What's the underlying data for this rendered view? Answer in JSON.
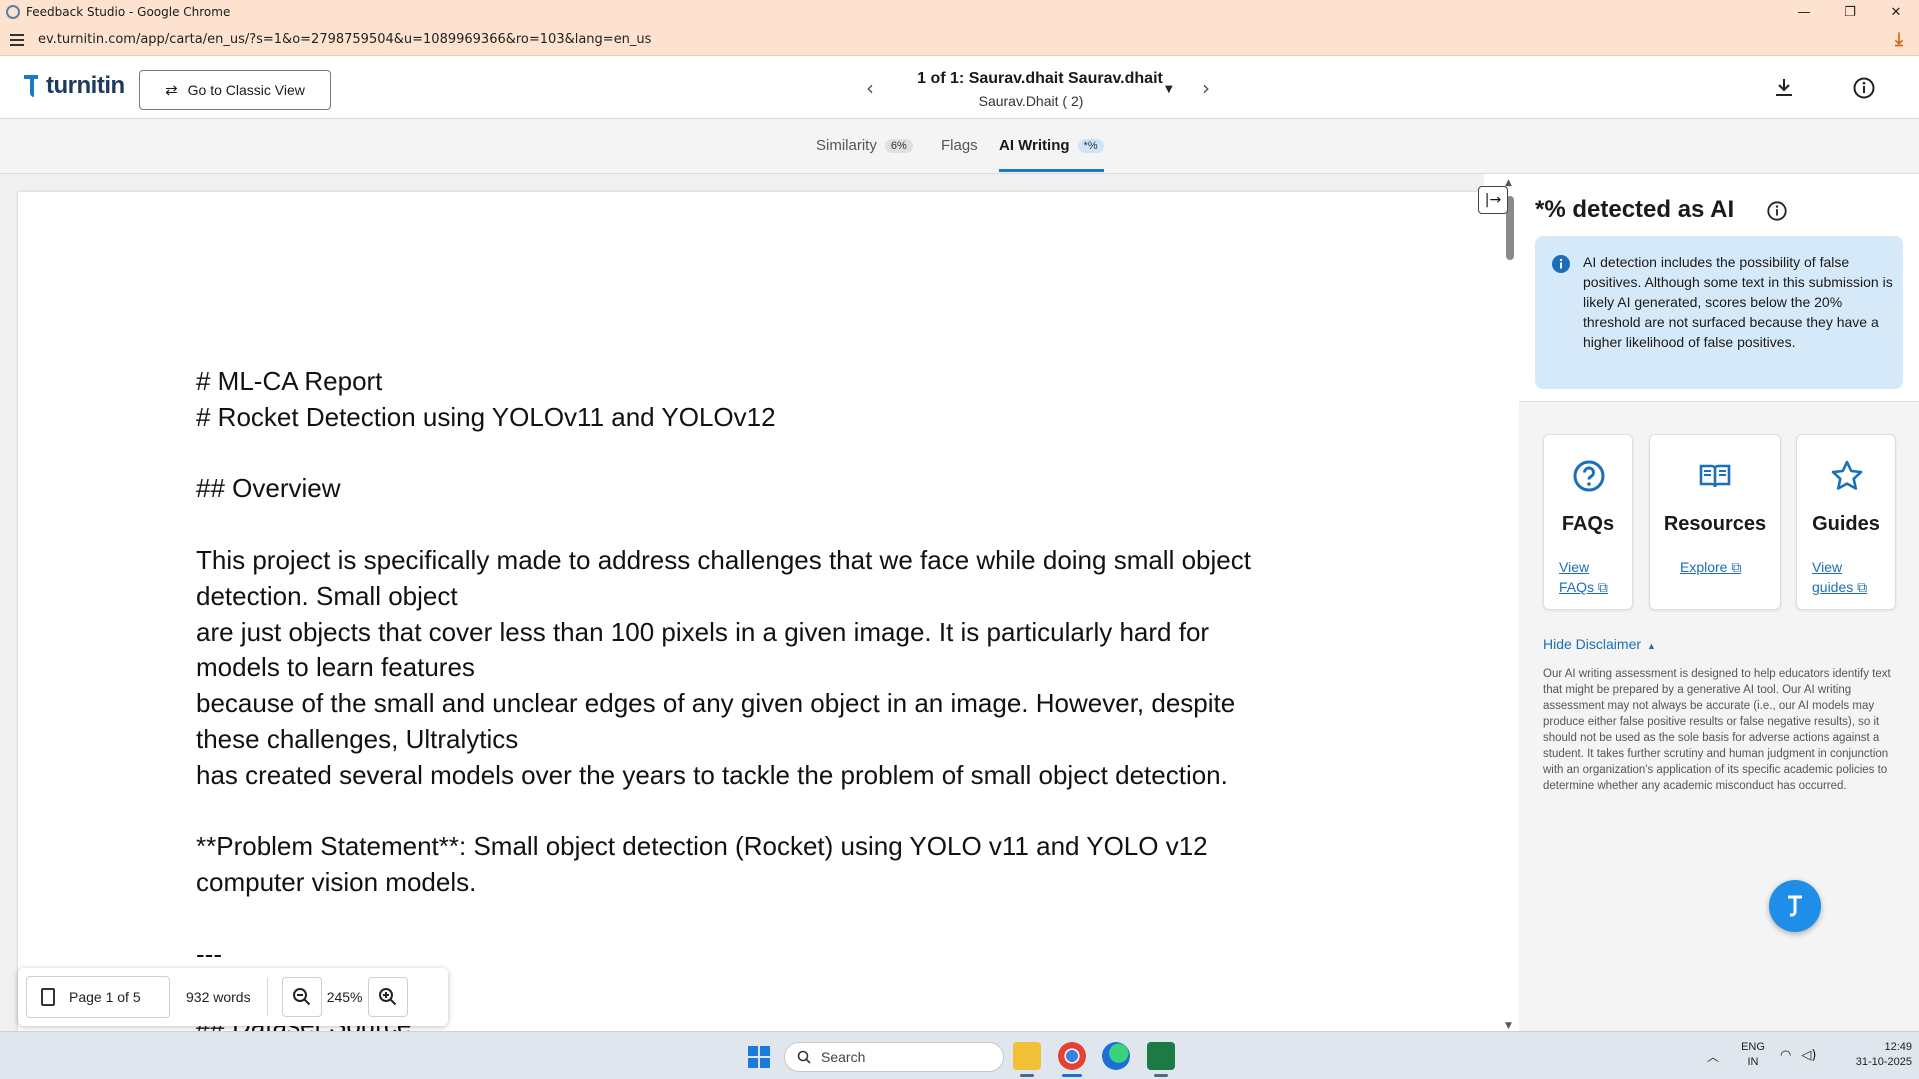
{
  "window": {
    "title": "Feedback Studio - Google Chrome",
    "url": "ev.turnitin.com/app/carta/en_us/?s=1&o=2798759504&u=1089969366&ro=103&lang=en_us"
  },
  "header": {
    "logo_text": "turnitin",
    "classic_view_label": "Go to Classic View",
    "submission_title": "1 of 1: Saurav.dhait Saurav.dhait",
    "submission_subtitle": "Saurav.Dhait ( 2)"
  },
  "tabs": [
    {
      "label": "Similarity",
      "badge": "6%"
    },
    {
      "label": "Flags",
      "badge": ""
    },
    {
      "label": "AI Writing",
      "badge": "*%"
    }
  ],
  "document": {
    "lines": [
      "# ML-CA Report",
      "# Rocket Detection using YOLOv11 and YOLOv12",
      "",
      "## Overview",
      "",
      "This project is specifically made to address challenges that we face while doing small object",
      "detection. Small object",
      "are just objects that cover less than 100 pixels in a given image. It is particularly hard for",
      "models to learn features",
      "because of the small and unclear edges of any given object in an image. However, despite",
      "these challenges, Ultralytics",
      "has created several models over the years to tackle the problem of small object detection.",
      "",
      "**Problem Statement**: Small object detection (Rocket) using YOLO v11 and YOLO v12",
      "computer vision models.",
      "",
      "---",
      "",
      "## Dataset Source"
    ]
  },
  "toolbar": {
    "page_label": "Page 1 of 5",
    "word_count": "932 words",
    "zoom_level": "245%"
  },
  "ai_panel": {
    "title": "*% detected as AI",
    "notice": "AI detection includes the possibility of false positives. Although some text in this submission is likely AI generated, scores below the 20% threshold are not surfaced because they have a higher likelihood of false positives.",
    "cards": [
      {
        "title": "FAQs",
        "link": "View FAQs",
        "icon": "question-circle-icon"
      },
      {
        "title": "Resources",
        "link": "Explore",
        "icon": "book-icon"
      },
      {
        "title": "Guides",
        "link": "View guides",
        "icon": "star-icon"
      }
    ],
    "hide_disclaimer": "Hide Disclaimer",
    "disclaimer": "Our AI writing assessment is designed to help educators identify text that might be prepared by a generative AI tool. Our AI writing assessment may not always be accurate (i.e., our AI models may produce either false positive results or false negative results), so it should not be used as the sole basis for adverse actions against a student. It takes further scrutiny and human judgment in conjunction with an organization's application of its specific academic policies to determine whether any academic misconduct has occurred."
  },
  "taskbar": {
    "search_placeholder": "Search",
    "lang_line1": "ENG",
    "lang_line2": "IN",
    "time": "12:49",
    "date": "31-10-2025"
  },
  "colors": {
    "accent": "#1a7ac8",
    "notice_bg": "#d6e9f9",
    "chrome_frame": "#fde3cf"
  }
}
